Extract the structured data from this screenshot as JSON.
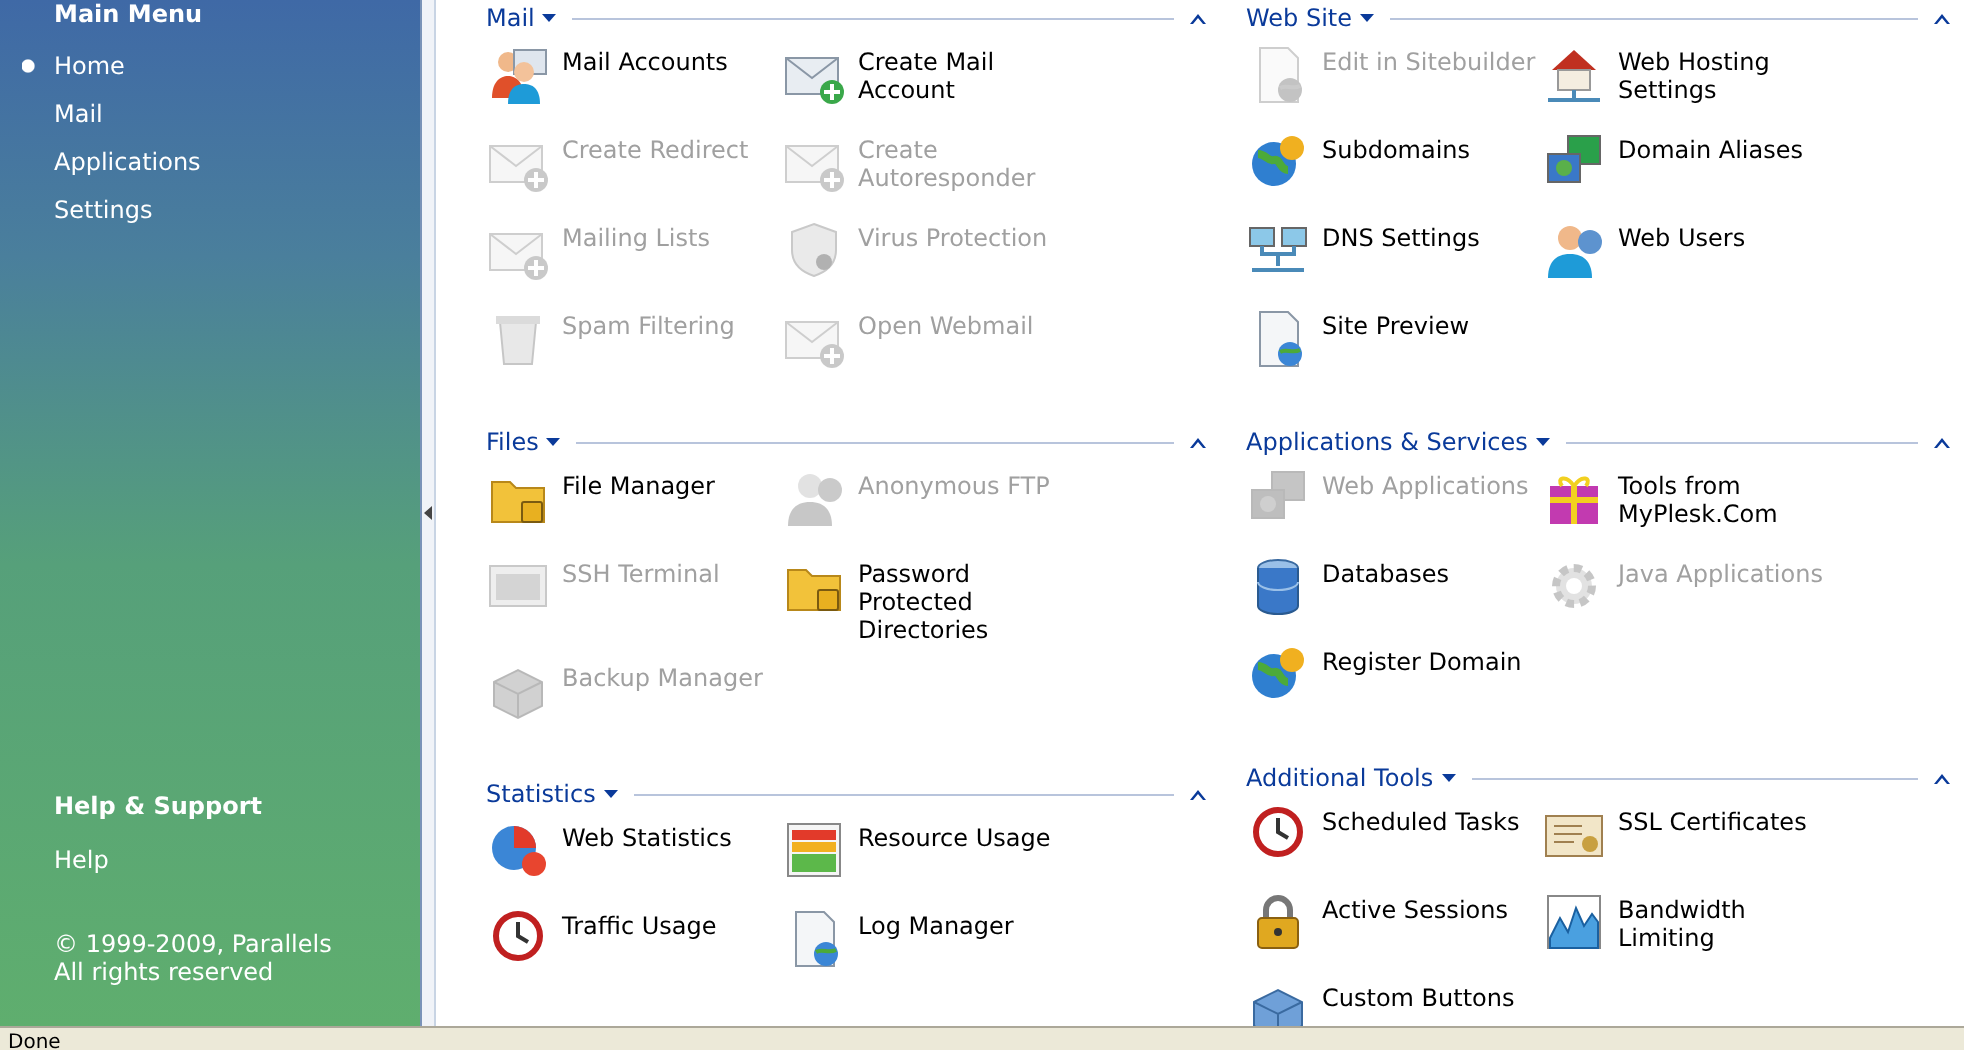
{
  "sidebar": {
    "title": "Main Menu",
    "items": [
      {
        "label": "Home",
        "selected": true
      },
      {
        "label": "Mail",
        "selected": false
      },
      {
        "label": "Applications",
        "selected": false
      },
      {
        "label": "Settings",
        "selected": false
      }
    ],
    "help": {
      "title": "Help & Support",
      "items": [
        "Help"
      ]
    },
    "copyright": [
      "© 1999-2009, Parallels",
      "All rights reserved"
    ]
  },
  "columns": [
    [
      {
        "title": "Mail",
        "items": [
          {
            "label": "Mail Accounts",
            "kind": "people",
            "disabled": false
          },
          {
            "label": "Create Mail Account",
            "kind": "envelope",
            "disabled": false
          },
          {
            "label": "Create Redirect",
            "kind": "envelope",
            "disabled": true
          },
          {
            "label": "Create Autoresponder",
            "kind": "envelope",
            "disabled": true
          },
          {
            "label": "Mailing Lists",
            "kind": "envelope",
            "disabled": true
          },
          {
            "label": "Virus Protection",
            "kind": "shield",
            "disabled": true
          },
          {
            "label": "Spam Filtering",
            "kind": "trash",
            "disabled": true
          },
          {
            "label": "Open Webmail",
            "kind": "envelope",
            "disabled": true
          }
        ]
      },
      {
        "title": "Files",
        "items": [
          {
            "label": "File Manager",
            "kind": "folder",
            "disabled": false
          },
          {
            "label": "Anonymous FTP",
            "kind": "person",
            "disabled": true
          },
          {
            "label": "SSH Terminal",
            "kind": "terminal",
            "disabled": true
          },
          {
            "label": "Password Protected Directories",
            "kind": "folder",
            "disabled": false
          },
          {
            "label": "Backup Manager",
            "kind": "box",
            "disabled": true
          }
        ]
      },
      {
        "title": "Statistics",
        "items": [
          {
            "label": "Web Statistics",
            "kind": "pie",
            "disabled": false
          },
          {
            "label": "Resource Usage",
            "kind": "bars",
            "disabled": false
          },
          {
            "label": "Traffic Usage",
            "kind": "clock",
            "disabled": false
          },
          {
            "label": "Log Manager",
            "kind": "document",
            "disabled": false
          }
        ]
      }
    ],
    [
      {
        "title": "Web Site",
        "items": [
          {
            "label": "Edit in Sitebuilder",
            "kind": "document",
            "disabled": true
          },
          {
            "label": "Web Hosting Settings",
            "kind": "house",
            "disabled": false
          },
          {
            "label": "Subdomains",
            "kind": "globe",
            "disabled": false
          },
          {
            "label": "Domain Aliases",
            "kind": "monitor",
            "disabled": false
          },
          {
            "label": "DNS Settings",
            "kind": "network",
            "disabled": false
          },
          {
            "label": "Web Users",
            "kind": "person",
            "disabled": false
          },
          {
            "label": "Site Preview",
            "kind": "document",
            "disabled": false
          }
        ]
      },
      {
        "title": "Applications & Services",
        "items": [
          {
            "label": "Web Applications",
            "kind": "monitor",
            "disabled": true
          },
          {
            "label": "Tools from MyPlesk.Com",
            "kind": "gift",
            "disabled": false
          },
          {
            "label": "Databases",
            "kind": "database",
            "disabled": false
          },
          {
            "label": "Java Applications",
            "kind": "gear",
            "disabled": true
          },
          {
            "label": "Register Domain",
            "kind": "globe",
            "disabled": false
          }
        ]
      },
      {
        "title": "Additional Tools",
        "items": [
          {
            "label": "Scheduled Tasks",
            "kind": "clock",
            "disabled": false
          },
          {
            "label": "SSL Certificates",
            "kind": "certificate",
            "disabled": false
          },
          {
            "label": "Active Sessions",
            "kind": "lock",
            "disabled": false
          },
          {
            "label": "Bandwidth Limiting",
            "kind": "linechart",
            "disabled": false
          },
          {
            "label": "Custom Buttons",
            "kind": "box",
            "disabled": false
          }
        ]
      }
    ]
  ],
  "status_bar": "Done"
}
